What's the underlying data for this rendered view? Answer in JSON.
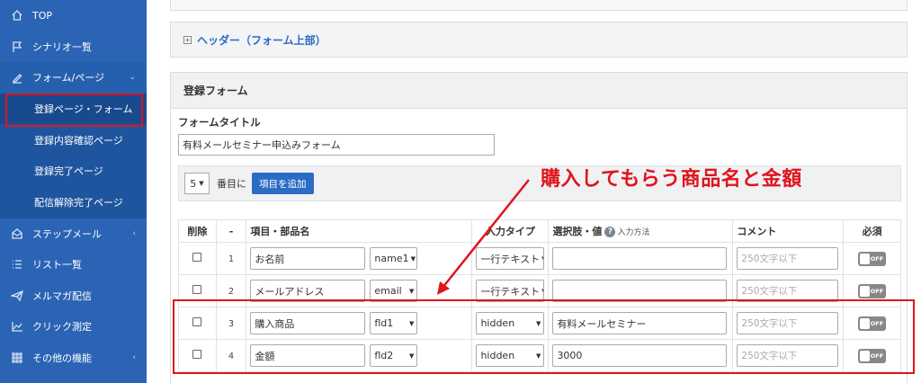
{
  "sidebar": {
    "items": [
      {
        "label": "TOP",
        "icon": "home-icon"
      },
      {
        "label": "シナリオ一覧",
        "icon": "flag-icon"
      },
      {
        "label": "フォーム/ページ",
        "icon": "pen-icon",
        "chevron": "⌄"
      },
      {
        "label": "ステップメール",
        "icon": "envelope-icon",
        "chevron": "‹"
      },
      {
        "label": "リスト一覧",
        "icon": "list-icon"
      },
      {
        "label": "メルマガ配信",
        "icon": "paper-plane-icon"
      },
      {
        "label": "クリック測定",
        "icon": "chart-icon"
      },
      {
        "label": "その他の機能",
        "icon": "grid-icon",
        "chevron": "‹"
      }
    ],
    "subitems": [
      {
        "label": "登録ページ・フォーム"
      },
      {
        "label": "登録内容確認ページ"
      },
      {
        "label": "登録完了ページ"
      },
      {
        "label": "配信解除完了ページ"
      }
    ]
  },
  "header_panel": {
    "title": "ヘッダー（フォーム上部）",
    "toggle": "+"
  },
  "form": {
    "panel_title": "登録フォーム",
    "title_label": "フォームタイトル",
    "title_value": "有料メールセミナー申込みフォーム",
    "position_select": "5",
    "position_suffix": "番目に",
    "add_button": "項目を追加"
  },
  "table": {
    "headers": {
      "delete": "削除",
      "index": "-",
      "name": "項目・部品名",
      "type": "入力タイプ",
      "choices": "選択肢・値",
      "choices_help": "?",
      "choices_sub": "入力方法",
      "comment": "コメント",
      "required": "必須"
    },
    "rows": [
      {
        "num": "1",
        "name": "お名前",
        "field": "name1",
        "type": "一行テキスト",
        "value": "",
        "comment_placeholder": "250文字以下",
        "required": "OFF"
      },
      {
        "num": "2",
        "name": "メールアドレス",
        "field": "email",
        "type": "一行テキスト",
        "value": "",
        "comment_placeholder": "250文字以下",
        "required": "OFF"
      },
      {
        "num": "3",
        "name": "購入商品",
        "field": "fld1",
        "type": "hidden",
        "value": "有料メールセミナー",
        "comment_placeholder": "250文字以下",
        "required": "OFF"
      },
      {
        "num": "4",
        "name": "金額",
        "field": "fld2",
        "type": "hidden",
        "value": "3000",
        "comment_placeholder": "250文字以下",
        "required": "OFF"
      }
    ]
  },
  "annotation": {
    "text": "購入してもらう商品名と金額",
    "color": "#e0141b"
  },
  "colors": {
    "sidebar": "#2b64b4",
    "accent": "#2b6cc4",
    "highlight": "#e0141b"
  }
}
